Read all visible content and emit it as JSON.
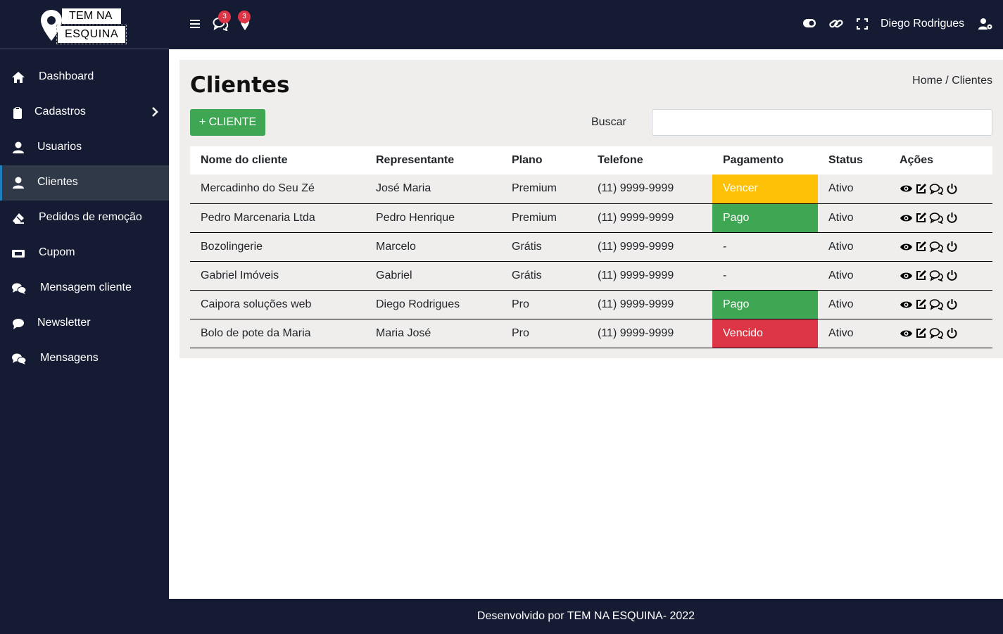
{
  "brand": {
    "line1": "TEM NA",
    "line2": "ESQUINA"
  },
  "sidebar": {
    "items": [
      {
        "label": "Dashboard",
        "icon": "home-icon"
      },
      {
        "label": "Cadastros",
        "icon": "clipboard-icon"
      },
      {
        "label": "Usuarios",
        "icon": "user-icon"
      },
      {
        "label": "Clientes",
        "icon": "user-icon"
      },
      {
        "label": "Pedidos de remoção",
        "icon": "eraser-icon"
      },
      {
        "label": "Cupom",
        "icon": "ticket-icon"
      },
      {
        "label": "Mensagem cliente",
        "icon": "comments-icon"
      },
      {
        "label": "Newsletter",
        "icon": "comment-icon"
      },
      {
        "label": "Mensagens",
        "icon": "comments-icon"
      }
    ]
  },
  "topbar": {
    "messages_badge": "3",
    "location_badge": "3",
    "username": "Diego Rodrigues"
  },
  "page": {
    "title": "Clientes",
    "breadcrumb": "Home / Clientes",
    "add_button": "+ CLIENTE",
    "search_label": "Buscar",
    "search_value": ""
  },
  "table": {
    "headers": [
      "Nome do cliente",
      "Representante",
      "Plano",
      "Telefone",
      "Pagamento",
      "Status",
      "Ações"
    ],
    "rows": [
      {
        "name": "Mercadinho do Seu Zé",
        "rep": "José Maria",
        "plan": "Premium",
        "phone": "(11) 9999-9999",
        "payment": "Vencer",
        "payment_color": "#ffc107",
        "status": "Ativo"
      },
      {
        "name": "Pedro Marcenaria Ltda",
        "rep": "Pedro Henrique",
        "plan": "Premium",
        "phone": "(11) 9999-9999",
        "payment": "Pago",
        "payment_color": "#3fa653",
        "status": "Ativo"
      },
      {
        "name": "Bozolingerie",
        "rep": "Marcelo",
        "plan": "Grátis",
        "phone": "(11) 9999-9999",
        "payment": "-",
        "payment_color": "",
        "status": "Ativo"
      },
      {
        "name": "Gabriel Imóveis",
        "rep": "Gabriel",
        "plan": "Grátis",
        "phone": "(11) 9999-9999",
        "payment": "-",
        "payment_color": "",
        "status": "Ativo"
      },
      {
        "name": "Caipora soluções web",
        "rep": "Diego Rodrigues",
        "plan": "Pro",
        "phone": "(11) 9999-9999",
        "payment": "Pago",
        "payment_color": "#3fa653",
        "status": "Ativo"
      },
      {
        "name": "Bolo de pote da Maria",
        "rep": "Maria José",
        "plan": "Pro",
        "phone": "(11) 9999-9999",
        "payment": "Vencido",
        "payment_color": "#dc3545",
        "status": "Ativo"
      }
    ]
  },
  "footer": {
    "text": "Desenvolvido por TEM NA ESQUINA- 2022"
  },
  "colors": {
    "navy": "#151b33",
    "content_bg": "#f0eeed",
    "green": "#3fa653",
    "yellow": "#ffc107",
    "red": "#dc3545"
  }
}
